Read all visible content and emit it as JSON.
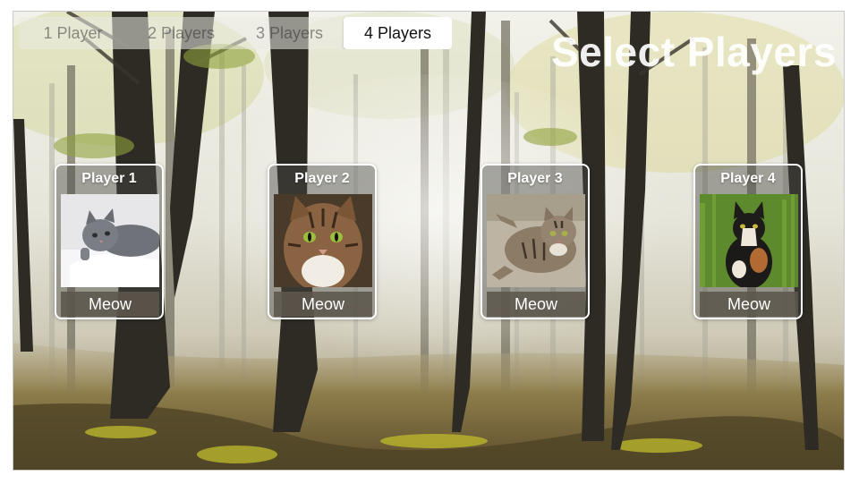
{
  "segmented_control": {
    "options": [
      "1 Player",
      "2 Players",
      "3 Players",
      "4 Players"
    ],
    "selected": "4 Players"
  },
  "title": "Select Players",
  "players": [
    {
      "label": "Player 1",
      "button": "Meow"
    },
    {
      "label": "Player 2",
      "button": "Meow"
    },
    {
      "label": "Player 3",
      "button": "Meow"
    },
    {
      "label": "Player 4",
      "button": "Meow"
    }
  ],
  "colors": {
    "selected_segment": "#ffffff",
    "card_border": "#ffffff",
    "button_background": "#5c564c"
  },
  "icons": {
    "background": "misty-forest-image",
    "player_photos": [
      "gray-kitten-photo",
      "tabby-cat-photo",
      "tabby-lying-cat-photo",
      "tortoiseshell-cat-photo"
    ]
  }
}
